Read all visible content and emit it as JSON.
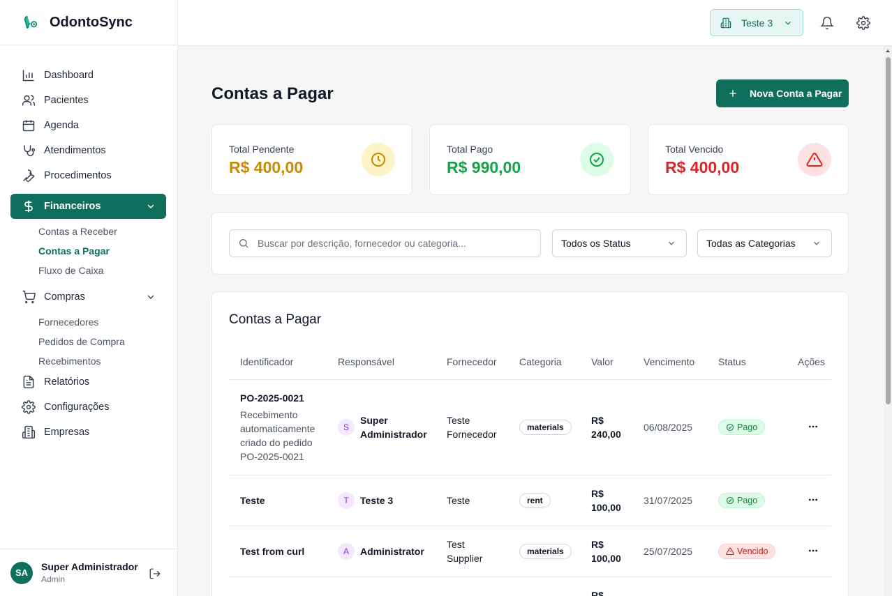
{
  "brand": {
    "name": "OdontoSync"
  },
  "nav": {
    "dashboard": "Dashboard",
    "pacientes": "Pacientes",
    "agenda": "Agenda",
    "atendimentos": "Atendimentos",
    "procedimentos": "Procedimentos",
    "financeiros": "Financeiros",
    "financeiros_sub": [
      "Contas a Receber",
      "Contas a Pagar",
      "Fluxo de Caixa"
    ],
    "compras": "Compras",
    "compras_sub": [
      "Fornecedores",
      "Pedidos de Compra",
      "Recebimentos"
    ],
    "relatorios": "Relatórios",
    "configuracoes": "Configurações",
    "empresas": "Empresas"
  },
  "user": {
    "initials": "SA",
    "name": "Super Administrador",
    "role": "Admin"
  },
  "topbar": {
    "company": "Teste 3"
  },
  "page": {
    "title": "Contas a Pagar",
    "new_button": "Nova Conta a Pagar"
  },
  "stats": {
    "pendente": {
      "label": "Total Pendente",
      "value": "R$ 400,00",
      "color": "#ca8a04"
    },
    "pago": {
      "label": "Total Pago",
      "value": "R$ 990,00",
      "color": "#16a34a"
    },
    "vencido": {
      "label": "Total Vencido",
      "value": "R$ 400,00",
      "color": "#dc2626"
    }
  },
  "filters": {
    "search_placeholder": "Buscar por descrição, fornecedor ou categoria...",
    "status": "Todos os Status",
    "category": "Todas as Categorias"
  },
  "table": {
    "title": "Contas a Pagar",
    "headers": [
      "Identificador",
      "Responsável",
      "Fornecedor",
      "Categoria",
      "Valor",
      "Vencimento",
      "Status",
      "Ações"
    ],
    "rows": [
      {
        "id": "PO-2025-0021",
        "desc": [
          "Recebimento",
          "automaticamente",
          "criado do pedido",
          "PO-2025-0021"
        ],
        "resp_initial": "S",
        "resp_name": [
          "Super",
          "Administrador"
        ],
        "supplier": [
          "Teste",
          "Fornecedor"
        ],
        "category": "materials",
        "value": [
          "R$",
          "240,00"
        ],
        "due": "06/08/2025",
        "status": "Pago"
      },
      {
        "id": "Teste",
        "resp_initial": "T",
        "resp_name": [
          "Teste 3"
        ],
        "supplier": [
          "Teste"
        ],
        "category": "rent",
        "value": [
          "R$",
          "100,00"
        ],
        "due": "31/07/2025",
        "status": "Pago"
      },
      {
        "id": "Test from curl",
        "resp_initial": "A",
        "resp_name": [
          "Administrator"
        ],
        "supplier": [
          "Test",
          "Supplier"
        ],
        "category": "materials",
        "value": [
          "R$",
          "100,00"
        ],
        "due": "25/07/2025",
        "status": "Vencido"
      },
      {
        "value": [
          "R$"
        ]
      }
    ]
  }
}
